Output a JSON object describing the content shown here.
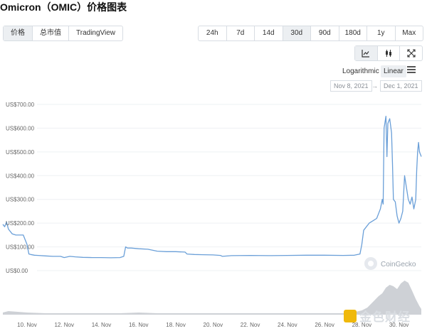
{
  "title": "Omicron（OMIC）价格图表",
  "view_tabs": [
    "价格",
    "总市值",
    "TradingView"
  ],
  "range_tabs": [
    "24h",
    "7d",
    "14d",
    "30d",
    "90d",
    "180d",
    "1y",
    "Max"
  ],
  "range_selected": "30d",
  "chart_type_icons": [
    "line-chart-icon",
    "candlestick-icon",
    "expand-icon"
  ],
  "scale": {
    "log_label": "Logarithmic",
    "linear_label": "Linear",
    "selected": "Linear"
  },
  "dates": {
    "from": "Nov 8, 2021",
    "to": "Dec 1, 2021",
    "arrow": "→"
  },
  "watermark": "CoinGecko",
  "corner_watermark": "金色财经",
  "colors": {
    "line": "#6a9fd8",
    "volume": "#c9ccd1",
    "grid": "#eef0f3"
  },
  "chart_data": {
    "type": "line",
    "title": "",
    "xlabel": "",
    "ylabel": "",
    "y_ticks": [
      "US$700.00",
      "US$600.00",
      "US$500.00",
      "US$400.00",
      "US$300.00",
      "US$200.00",
      "US$100.00",
      "US$0.00"
    ],
    "y_tick_values": [
      700,
      600,
      500,
      400,
      300,
      200,
      100,
      0
    ],
    "ylim": [
      0,
      700
    ],
    "x_ticks": [
      "10. Nov",
      "12. Nov",
      "14. Nov",
      "16. Nov",
      "18. Nov",
      "20. Nov",
      "22. Nov",
      "24. Nov",
      "26. Nov",
      "28. Nov",
      "30. Nov"
    ],
    "x_tick_days": [
      10,
      12,
      14,
      16,
      18,
      20,
      22,
      24,
      26,
      28,
      30
    ],
    "xlim_days": [
      8.7,
      31.2
    ],
    "grid": true,
    "series": [
      {
        "x": [
          8.7,
          8.8,
          8.9,
          9.0,
          9.2,
          9.4,
          9.8,
          10.0,
          10.1,
          10.2,
          10.4,
          10.6,
          11.0,
          11.4,
          11.8,
          12.0,
          12.3,
          12.6,
          13.0,
          13.5,
          14.0,
          14.5,
          15.0,
          15.2,
          15.3,
          15.4,
          15.6,
          16.0,
          16.5,
          17.0,
          17.5,
          18.0,
          18.5,
          18.6,
          19.0,
          19.5,
          20.0,
          20.4,
          20.5,
          21.0,
          22.0,
          23.0,
          24.0,
          25.0,
          26.0,
          27.0,
          27.6,
          27.9,
          28.0,
          28.1,
          28.2,
          28.4,
          28.6,
          28.8,
          28.9,
          29.0,
          29.1,
          29.15,
          29.2,
          29.3,
          29.35,
          29.4,
          29.5,
          29.6,
          29.65,
          29.7,
          29.8,
          29.9,
          30.0,
          30.1,
          30.2,
          30.3,
          30.4,
          30.5,
          30.6,
          30.7,
          30.8,
          30.9,
          30.95,
          31.0,
          31.05,
          31.1,
          31.2
        ],
        "y": [
          195,
          185,
          205,
          175,
          155,
          150,
          150,
          110,
          70,
          68,
          65,
          64,
          62,
          60,
          60,
          55,
          60,
          58,
          56,
          55,
          55,
          54,
          55,
          60,
          100,
          95,
          95,
          92,
          90,
          82,
          80,
          80,
          78,
          70,
          68,
          67,
          66,
          64,
          60,
          63,
          64,
          63,
          64,
          65,
          65,
          64,
          65,
          70,
          110,
          170,
          180,
          200,
          210,
          220,
          240,
          260,
          300,
          280,
          600,
          650,
          480,
          620,
          640,
          580,
          450,
          300,
          290,
          230,
          200,
          220,
          250,
          400,
          350,
          300,
          280,
          310,
          260,
          300,
          420,
          500,
          540,
          500,
          480
        ]
      }
    ],
    "volume": {
      "x": [
        8.7,
        9,
        9.5,
        10,
        11,
        12,
        13,
        14,
        15,
        16,
        17,
        18,
        19,
        20,
        21,
        22,
        23,
        24,
        25,
        26,
        27,
        27.5,
        28,
        28.3,
        28.6,
        28.9,
        29.1,
        29.3,
        29.5,
        29.7,
        29.9,
        30.1,
        30.3,
        30.5,
        30.7,
        30.9,
        31.1,
        31.2
      ],
      "y": [
        3,
        5,
        4,
        3,
        2,
        2,
        2,
        2,
        2,
        3,
        2,
        2,
        2,
        2,
        2,
        2,
        2,
        2,
        2,
        2,
        2,
        3,
        6,
        10,
        18,
        26,
        30,
        38,
        42,
        40,
        36,
        44,
        48,
        45,
        34,
        22,
        12,
        8
      ],
      "ylim": [
        0,
        55
      ]
    }
  }
}
